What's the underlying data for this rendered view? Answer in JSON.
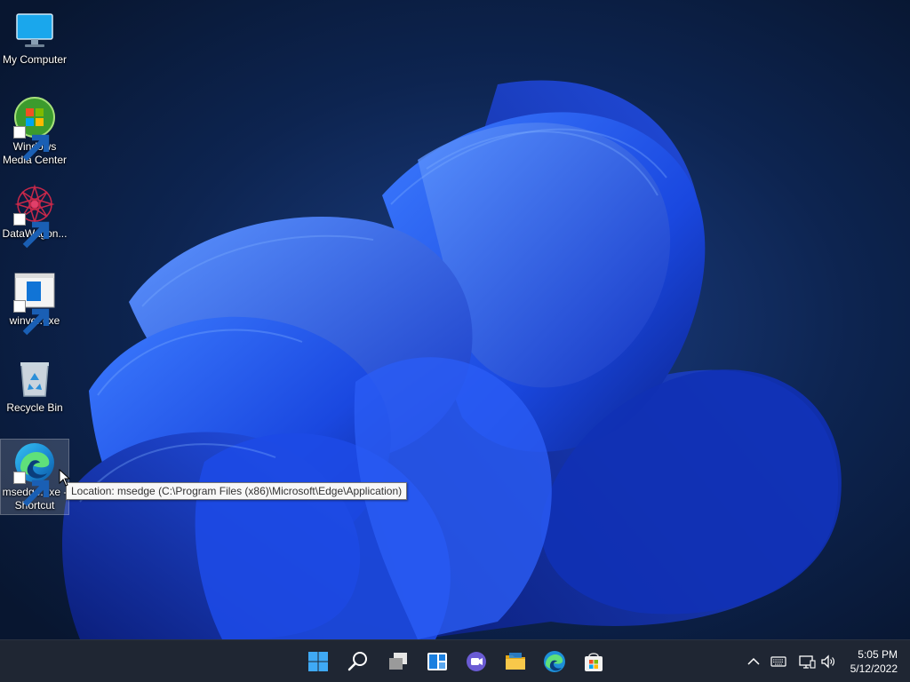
{
  "desktop": {
    "icons": [
      {
        "label": "My Computer",
        "icon": "monitor-icon"
      },
      {
        "label": "Windows Media Center",
        "icon": "windows-media-center-icon",
        "shortcut": true
      },
      {
        "label": "DataWagon...",
        "icon": "datawagon-icon",
        "shortcut": true
      },
      {
        "label": "winver.exe",
        "icon": "winver-icon",
        "shortcut": true
      },
      {
        "label": "Recycle Bin",
        "icon": "recycle-bin-icon"
      },
      {
        "label": "msedge.exe - Shortcut",
        "icon": "edge-icon",
        "shortcut": true,
        "selected": true
      }
    ],
    "tooltip": "Location: msedge (C:\\Program Files (x86)\\Microsoft\\Edge\\Application)"
  },
  "taskbar": {
    "apps": [
      {
        "name": "start-button",
        "icon": "windows-logo-icon"
      },
      {
        "name": "search-button",
        "icon": "search-icon"
      },
      {
        "name": "task-view-button",
        "icon": "task-view-icon"
      },
      {
        "name": "widgets-button",
        "icon": "widgets-icon"
      },
      {
        "name": "chat-button",
        "icon": "teams-chat-icon"
      },
      {
        "name": "file-explorer-button",
        "icon": "folder-icon"
      },
      {
        "name": "edge-button",
        "icon": "edge-icon"
      },
      {
        "name": "store-button",
        "icon": "store-icon"
      }
    ],
    "tray": [
      "chevron-up-icon",
      "keyboard-icon",
      "network-icon",
      "volume-icon"
    ],
    "clock": {
      "time": "5:05 PM",
      "date": "5/12/2022"
    }
  },
  "colors": {
    "taskbar": "#1f2633",
    "accent": "#0067c0"
  }
}
